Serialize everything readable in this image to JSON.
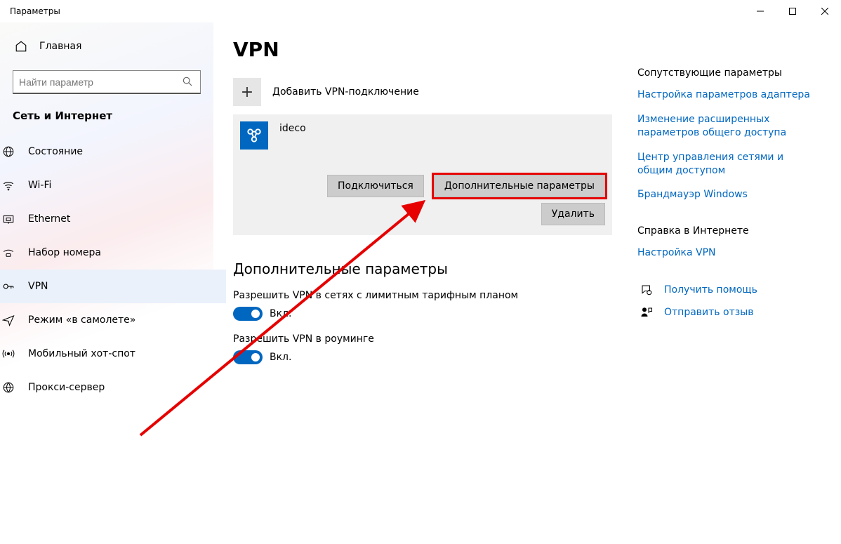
{
  "window": {
    "title": "Параметры"
  },
  "sidebar": {
    "home": "Главная",
    "search_placeholder": "Найти параметр",
    "category": "Сеть и Интернет",
    "items": [
      {
        "label": "Состояние",
        "icon": "globe-grid"
      },
      {
        "label": "Wi-Fi",
        "icon": "wifi"
      },
      {
        "label": "Ethernet",
        "icon": "ethernet"
      },
      {
        "label": "Набор номера",
        "icon": "dialup"
      },
      {
        "label": "VPN",
        "icon": "vpn-key",
        "active": true
      },
      {
        "label": "Режим «в самолете»",
        "icon": "airplane"
      },
      {
        "label": "Мобильный хот-спот",
        "icon": "hotspot"
      },
      {
        "label": "Прокси-сервер",
        "icon": "proxy"
      }
    ]
  },
  "main": {
    "title": "VPN",
    "add_vpn": "Добавить VPN-подключение",
    "connection": {
      "name": "ideco",
      "connect_btn": "Подключиться",
      "advanced_btn": "Дополнительные параметры",
      "delete_btn": "Удалить"
    },
    "advanced_heading": "Дополнительные параметры",
    "toggles": [
      {
        "label": "Разрешить VPN в сетях с лимитным тарифным планом",
        "state": "Вкл."
      },
      {
        "label": "Разрешить VPN в роуминге",
        "state": "Вкл."
      }
    ]
  },
  "aside": {
    "related_heading": "Сопутствующие параметры",
    "related_links": [
      "Настройка параметров адаптера",
      "Изменение расширенных параметров общего доступа",
      "Центр управления сетями и общим доступом",
      "Брандмауэр Windows"
    ],
    "help_heading": "Справка в Интернете",
    "help_links": [
      "Настройка VPN"
    ],
    "support": {
      "get_help": "Получить помощь",
      "feedback": "Отправить отзыв"
    }
  }
}
